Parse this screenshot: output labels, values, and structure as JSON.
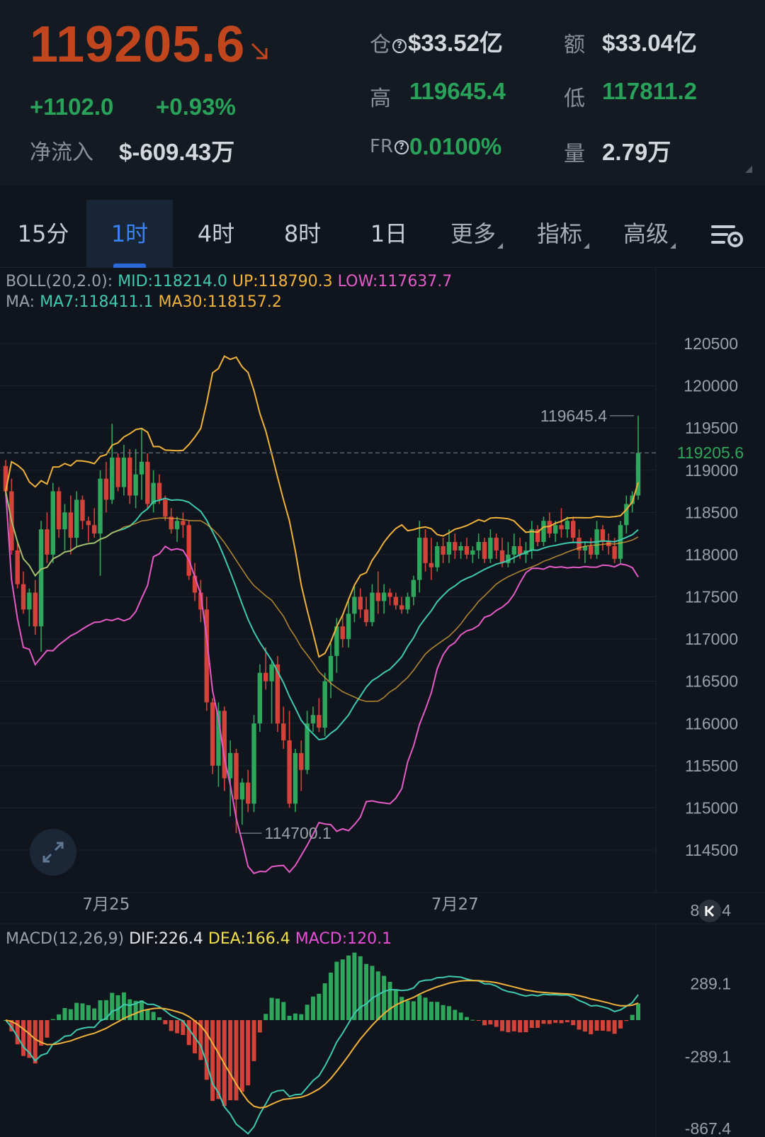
{
  "header": {
    "price": "119205.6",
    "change_abs": "+1102.0",
    "change_pct": "+0.93%",
    "netflow_label": "净流入",
    "netflow_value": "$-609.43万",
    "oi_label": "仓",
    "oi_value": "$33.52亿",
    "turnover_label": "额",
    "turnover_value": "$33.04亿",
    "high_label": "高",
    "high_value": "119645.4",
    "low_label": "低",
    "low_value": "117811.2",
    "fr_label": "FR",
    "fr_value": "0.0100%",
    "volume_label": "量",
    "volume_value": "2.79万"
  },
  "tabs": [
    {
      "label": "15分",
      "active": false
    },
    {
      "label": "1时",
      "active": true
    },
    {
      "label": "4时",
      "active": false
    },
    {
      "label": "8时",
      "active": false
    },
    {
      "label": "1日",
      "active": false
    },
    {
      "label": "更多",
      "active": false,
      "dropdown": true
    },
    {
      "label": "指标",
      "active": false,
      "dropdown": true
    },
    {
      "label": "高级",
      "active": false,
      "dropdown": true
    }
  ],
  "legend": {
    "boll_prefix": "BOLL(20,2.0):",
    "boll_mid": "MID:118214.0",
    "boll_up": "UP:118790.3",
    "boll_low": "LOW:117637.7",
    "ma_prefix": "MA:",
    "ma7": "MA7:118411.1",
    "ma30": "MA30:118157.2",
    "macd_prefix": "MACD(12,26,9)",
    "dif": "DIF:226.4",
    "dea": "DEA:166.4",
    "macd": "MACD:120.1"
  },
  "chart_data": {
    "type": "candlestick",
    "interval": "1时",
    "price_axis": {
      "ticks": [
        120500,
        120000,
        119500,
        119000,
        118500,
        118000,
        117500,
        117000,
        116500,
        116000,
        115500,
        115000,
        114500
      ],
      "current_price": 119205.6,
      "high_marker": 119645.4,
      "low_marker": 114700.1
    },
    "date_labels": [
      {
        "label": "7月25",
        "index": 17
      },
      {
        "label": "7月27",
        "index": 76
      }
    ],
    "candles": [
      {
        "o": 119050,
        "h": 119120,
        "l": 118700,
        "c": 118750
      },
      {
        "o": 118750,
        "h": 118900,
        "l": 118000,
        "c": 118050
      },
      {
        "o": 118050,
        "h": 118150,
        "l": 117600,
        "c": 117650
      },
      {
        "o": 117650,
        "h": 117800,
        "l": 117300,
        "c": 117350
      },
      {
        "o": 117350,
        "h": 117600,
        "l": 117150,
        "c": 117550
      },
      {
        "o": 117550,
        "h": 117700,
        "l": 117050,
        "c": 117150
      },
      {
        "o": 117150,
        "h": 118400,
        "l": 116850,
        "c": 118300
      },
      {
        "o": 118300,
        "h": 118500,
        "l": 117900,
        "c": 118000
      },
      {
        "o": 118000,
        "h": 118850,
        "l": 117900,
        "c": 118750
      },
      {
        "o": 118750,
        "h": 118800,
        "l": 118200,
        "c": 118300
      },
      {
        "o": 118300,
        "h": 118600,
        "l": 118050,
        "c": 118500
      },
      {
        "o": 118500,
        "h": 118700,
        "l": 118000,
        "c": 118200
      },
      {
        "o": 118200,
        "h": 118750,
        "l": 118100,
        "c": 118650
      },
      {
        "o": 118650,
        "h": 118700,
        "l": 118300,
        "c": 118400
      },
      {
        "o": 118400,
        "h": 118450,
        "l": 118150,
        "c": 118350
      },
      {
        "o": 118350,
        "h": 118550,
        "l": 118200,
        "c": 118250
      },
      {
        "o": 118250,
        "h": 119000,
        "l": 117750,
        "c": 118900
      },
      {
        "o": 118900,
        "h": 119100,
        "l": 118500,
        "c": 118650
      },
      {
        "o": 118650,
        "h": 119550,
        "l": 118600,
        "c": 119150
      },
      {
        "o": 119150,
        "h": 119200,
        "l": 118750,
        "c": 118800
      },
      {
        "o": 118800,
        "h": 119300,
        "l": 118700,
        "c": 119150
      },
      {
        "o": 119150,
        "h": 119250,
        "l": 118600,
        "c": 118700
      },
      {
        "o": 118700,
        "h": 119250,
        "l": 118550,
        "c": 118950
      },
      {
        "o": 118950,
        "h": 119500,
        "l": 118650,
        "c": 119100
      },
      {
        "o": 119100,
        "h": 119200,
        "l": 118550,
        "c": 118600
      },
      {
        "o": 118600,
        "h": 119000,
        "l": 118500,
        "c": 118850
      },
      {
        "o": 118850,
        "h": 118950,
        "l": 118600,
        "c": 118650
      },
      {
        "o": 118650,
        "h": 118700,
        "l": 118400,
        "c": 118450
      },
      {
        "o": 118450,
        "h": 118550,
        "l": 118250,
        "c": 118300
      },
      {
        "o": 118300,
        "h": 118450,
        "l": 118150,
        "c": 118400
      },
      {
        "o": 118400,
        "h": 118500,
        "l": 118200,
        "c": 118350
      },
      {
        "o": 118350,
        "h": 118400,
        "l": 117700,
        "c": 117750
      },
      {
        "o": 117750,
        "h": 117900,
        "l": 117450,
        "c": 117550
      },
      {
        "o": 117550,
        "h": 117700,
        "l": 117200,
        "c": 117350
      },
      {
        "o": 117350,
        "h": 117500,
        "l": 116150,
        "c": 116250
      },
      {
        "o": 116250,
        "h": 116300,
        "l": 115400,
        "c": 115500
      },
      {
        "o": 115500,
        "h": 116250,
        "l": 115250,
        "c": 116150
      },
      {
        "o": 116150,
        "h": 116200,
        "l": 115200,
        "c": 115350
      },
      {
        "o": 115350,
        "h": 115800,
        "l": 114900,
        "c": 115650
      },
      {
        "o": 115650,
        "h": 115700,
        "l": 114700,
        "c": 115100
      },
      {
        "o": 115100,
        "h": 115350,
        "l": 114800,
        "c": 115300
      },
      {
        "o": 115300,
        "h": 115450,
        "l": 114950,
        "c": 115050
      },
      {
        "o": 115050,
        "h": 116100,
        "l": 114950,
        "c": 116000
      },
      {
        "o": 116000,
        "h": 116700,
        "l": 115900,
        "c": 116600
      },
      {
        "o": 116600,
        "h": 116900,
        "l": 116400,
        "c": 116500
      },
      {
        "o": 116500,
        "h": 116750,
        "l": 116000,
        "c": 116700
      },
      {
        "o": 116700,
        "h": 116800,
        "l": 115900,
        "c": 116000
      },
      {
        "o": 116000,
        "h": 116200,
        "l": 115700,
        "c": 115800
      },
      {
        "o": 115800,
        "h": 116150,
        "l": 115000,
        "c": 115050
      },
      {
        "o": 115050,
        "h": 115700,
        "l": 114950,
        "c": 115650
      },
      {
        "o": 115650,
        "h": 115800,
        "l": 115200,
        "c": 115450
      },
      {
        "o": 115450,
        "h": 116150,
        "l": 115400,
        "c": 116000
      },
      {
        "o": 116000,
        "h": 116200,
        "l": 115900,
        "c": 116100
      },
      {
        "o": 116100,
        "h": 116300,
        "l": 115900,
        "c": 115950
      },
      {
        "o": 115950,
        "h": 116600,
        "l": 115850,
        "c": 116500
      },
      {
        "o": 116500,
        "h": 116950,
        "l": 116300,
        "c": 116800
      },
      {
        "o": 116800,
        "h": 117250,
        "l": 116600,
        "c": 117150
      },
      {
        "o": 117150,
        "h": 117300,
        "l": 116900,
        "c": 117000
      },
      {
        "o": 117000,
        "h": 117450,
        "l": 116900,
        "c": 117300
      },
      {
        "o": 117300,
        "h": 117650,
        "l": 117200,
        "c": 117500
      },
      {
        "o": 117500,
        "h": 117600,
        "l": 117250,
        "c": 117350
      },
      {
        "o": 117350,
        "h": 117500,
        "l": 117150,
        "c": 117200
      },
      {
        "o": 117200,
        "h": 117650,
        "l": 117150,
        "c": 117550
      },
      {
        "o": 117550,
        "h": 117800,
        "l": 117300,
        "c": 117450
      },
      {
        "o": 117450,
        "h": 117650,
        "l": 117300,
        "c": 117550
      },
      {
        "o": 117550,
        "h": 117600,
        "l": 117400,
        "c": 117500
      },
      {
        "o": 117500,
        "h": 117550,
        "l": 117350,
        "c": 117400
      },
      {
        "o": 117400,
        "h": 117500,
        "l": 117300,
        "c": 117350
      },
      {
        "o": 117350,
        "h": 117550,
        "l": 117300,
        "c": 117500
      },
      {
        "o": 117500,
        "h": 117750,
        "l": 117400,
        "c": 117700
      },
      {
        "o": 117700,
        "h": 118400,
        "l": 117550,
        "c": 118200
      },
      {
        "o": 118200,
        "h": 118300,
        "l": 117800,
        "c": 117900
      },
      {
        "o": 117900,
        "h": 118200,
        "l": 117700,
        "c": 117850
      },
      {
        "o": 117850,
        "h": 118150,
        "l": 117800,
        "c": 118100
      },
      {
        "o": 118100,
        "h": 118200,
        "l": 117900,
        "c": 118000
      },
      {
        "o": 118000,
        "h": 118300,
        "l": 117900,
        "c": 118150
      },
      {
        "o": 118150,
        "h": 118250,
        "l": 117950,
        "c": 118050
      },
      {
        "o": 118050,
        "h": 118150,
        "l": 117950,
        "c": 118100
      },
      {
        "o": 118100,
        "h": 118200,
        "l": 117950,
        "c": 118000
      },
      {
        "o": 118000,
        "h": 118100,
        "l": 117900,
        "c": 118050
      },
      {
        "o": 118050,
        "h": 118250,
        "l": 117950,
        "c": 118150
      },
      {
        "o": 118150,
        "h": 118200,
        "l": 117900,
        "c": 117950
      },
      {
        "o": 117950,
        "h": 118300,
        "l": 117900,
        "c": 118200
      },
      {
        "o": 118200,
        "h": 118250,
        "l": 117950,
        "c": 118050
      },
      {
        "o": 118050,
        "h": 118200,
        "l": 117850,
        "c": 117900
      },
      {
        "o": 117900,
        "h": 118150,
        "l": 117850,
        "c": 118000
      },
      {
        "o": 118000,
        "h": 118250,
        "l": 117900,
        "c": 118100
      },
      {
        "o": 118100,
        "h": 118200,
        "l": 117950,
        "c": 118000
      },
      {
        "o": 118000,
        "h": 118150,
        "l": 117900,
        "c": 118050
      },
      {
        "o": 118050,
        "h": 118400,
        "l": 117950,
        "c": 118300
      },
      {
        "o": 118300,
        "h": 118350,
        "l": 118100,
        "c": 118150
      },
      {
        "o": 118150,
        "h": 118450,
        "l": 118100,
        "c": 118400
      },
      {
        "o": 118400,
        "h": 118500,
        "l": 118200,
        "c": 118250
      },
      {
        "o": 118250,
        "h": 118400,
        "l": 118150,
        "c": 118350
      },
      {
        "o": 118350,
        "h": 118550,
        "l": 118200,
        "c": 118300
      },
      {
        "o": 118300,
        "h": 118450,
        "l": 118200,
        "c": 118400
      },
      {
        "o": 118400,
        "h": 118450,
        "l": 118150,
        "c": 118200
      },
      {
        "o": 118200,
        "h": 118300,
        "l": 117950,
        "c": 118050
      },
      {
        "o": 118050,
        "h": 118150,
        "l": 117900,
        "c": 118100
      },
      {
        "o": 118100,
        "h": 118200,
        "l": 117950,
        "c": 118000
      },
      {
        "o": 118000,
        "h": 118400,
        "l": 117950,
        "c": 118300
      },
      {
        "o": 118300,
        "h": 118350,
        "l": 118050,
        "c": 118150
      },
      {
        "o": 118150,
        "h": 118250,
        "l": 118000,
        "c": 118100
      },
      {
        "o": 118100,
        "h": 118200,
        "l": 117900,
        "c": 117950
      },
      {
        "o": 117950,
        "h": 118400,
        "l": 117900,
        "c": 118350
      },
      {
        "o": 118350,
        "h": 118700,
        "l": 118250,
        "c": 118600
      },
      {
        "o": 118600,
        "h": 118750,
        "l": 118500,
        "c": 118700
      },
      {
        "o": 118700,
        "h": 119645.4,
        "l": 118650,
        "c": 119205.6
      }
    ],
    "macd": {
      "axis_ticks": [
        867.4,
        289.1,
        -289.1,
        -867.4
      ]
    },
    "colors": {
      "up": "#2ea65c",
      "down": "#d3433a",
      "boll_mid": "#3fc9b0",
      "boll_up": "#f0b23a",
      "boll_low": "#e45bc8",
      "dif": "#3fc9b0",
      "dea": "#f0b23a",
      "macd_label": "#e84fd8"
    }
  }
}
